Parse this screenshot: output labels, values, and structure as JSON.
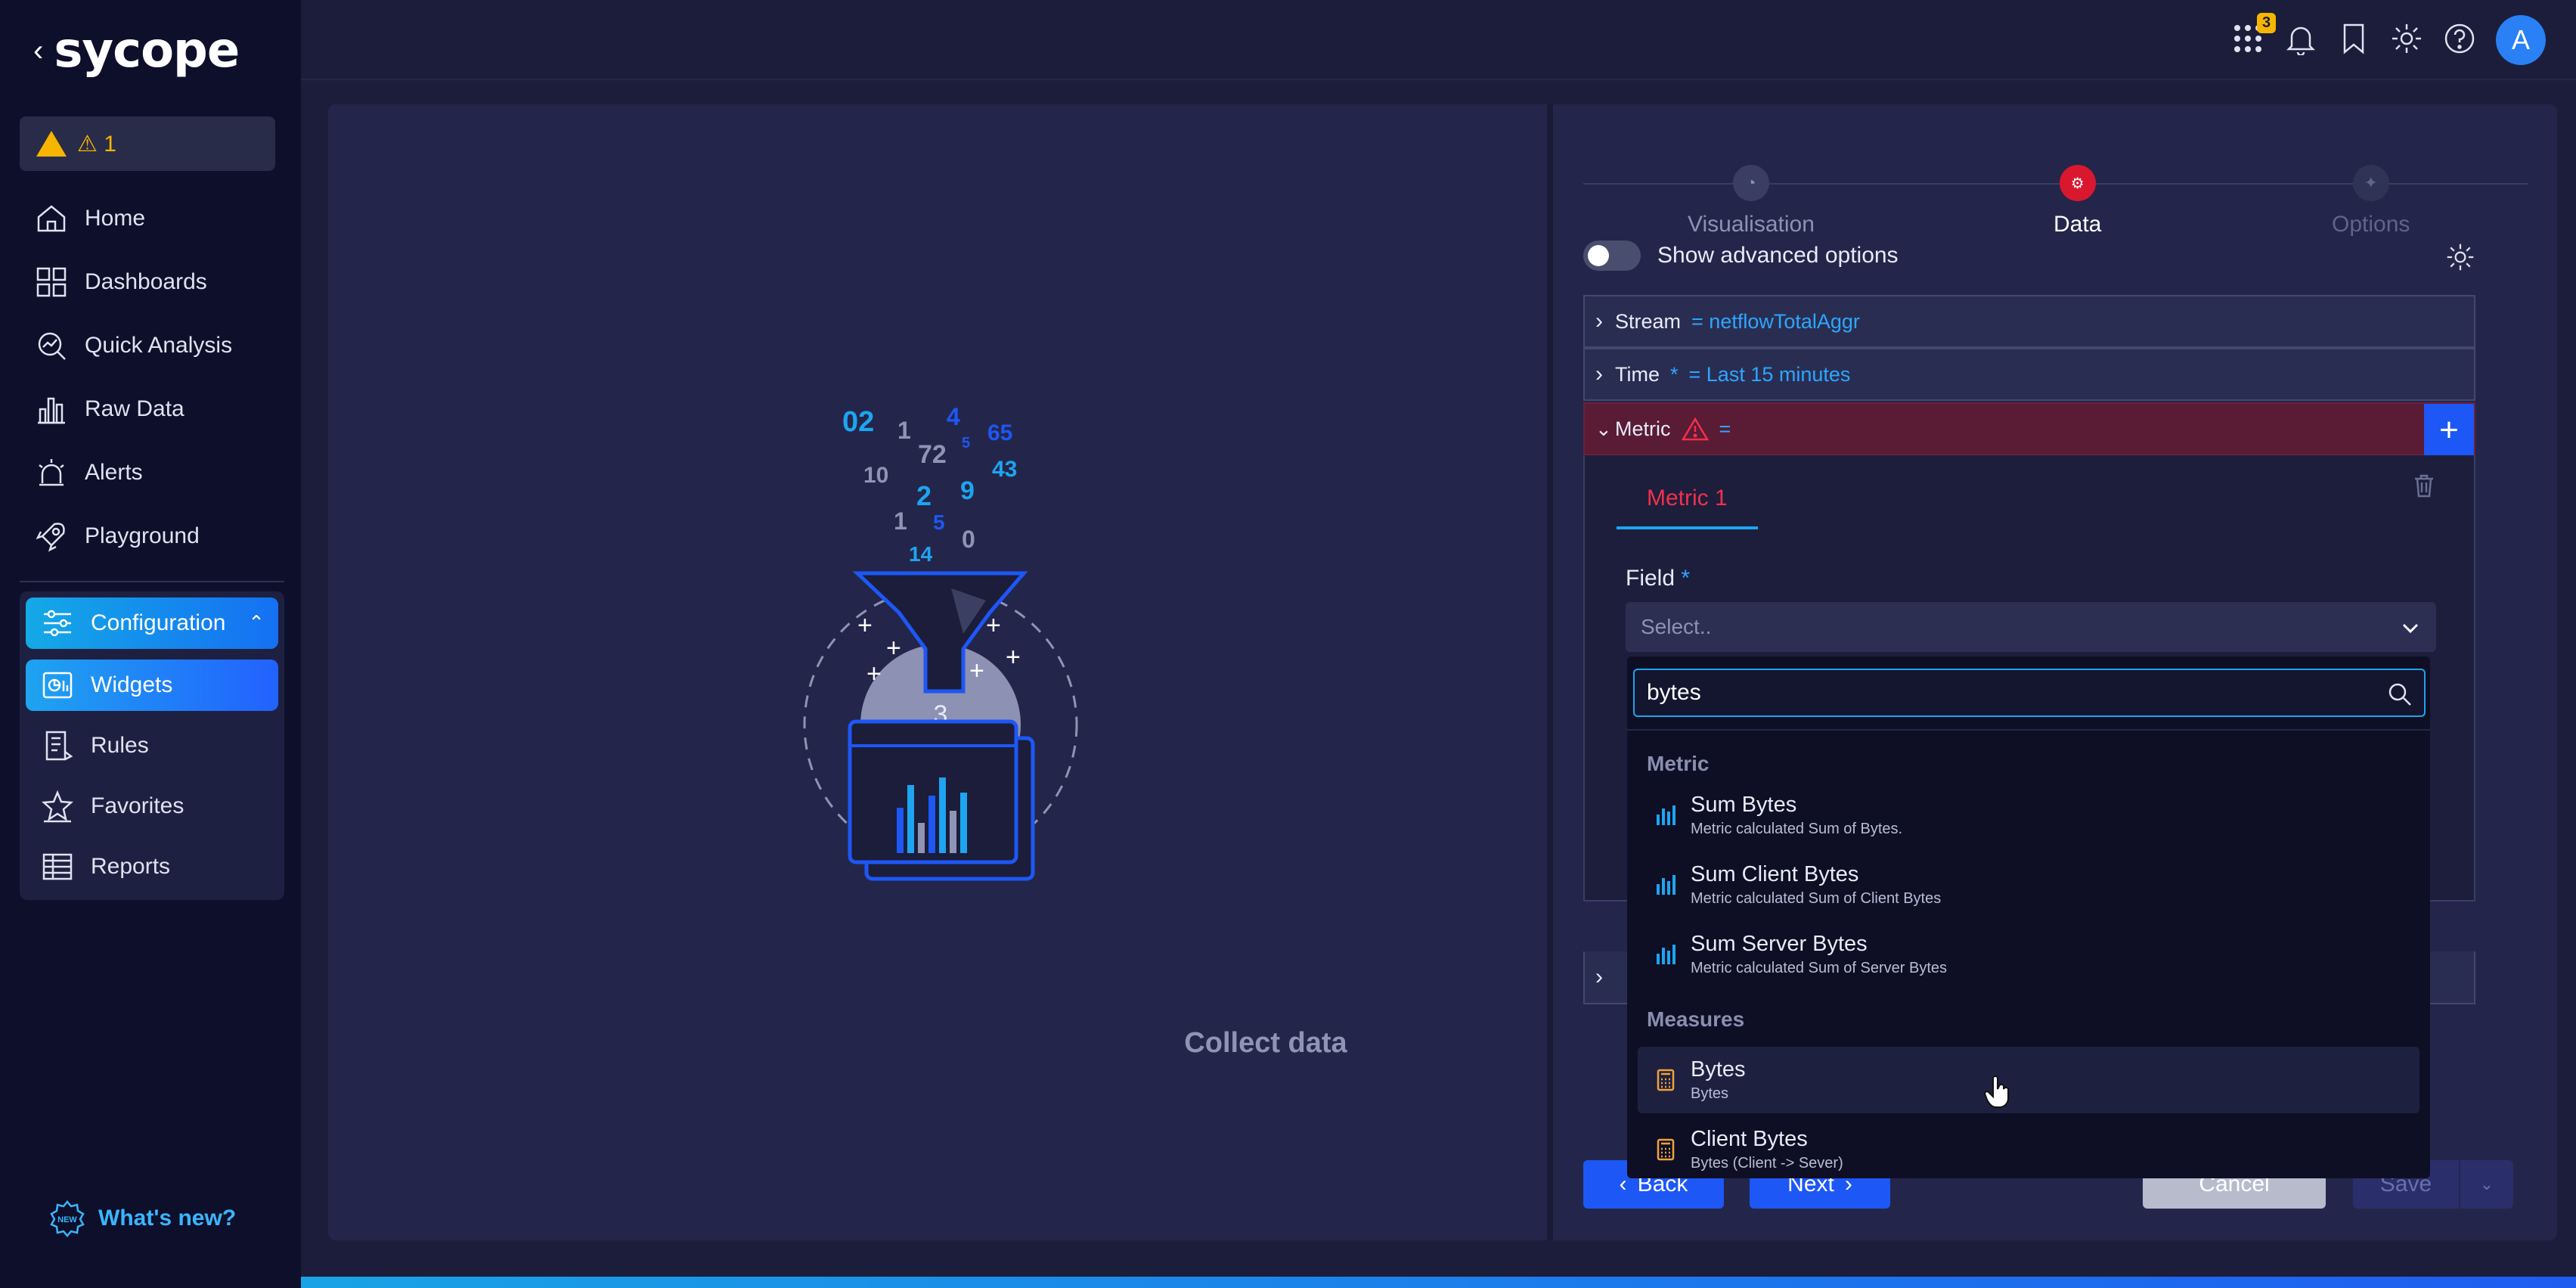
{
  "brand": {
    "logo_text": "sycope"
  },
  "alerts": {
    "count_label": "⚠ 1"
  },
  "sidebar": {
    "items": [
      {
        "label": "Home"
      },
      {
        "label": "Dashboards"
      },
      {
        "label": "Quick Analysis"
      },
      {
        "label": "Raw Data"
      },
      {
        "label": "Alerts"
      },
      {
        "label": "Playground"
      }
    ],
    "config": {
      "label": "Configuration",
      "children": [
        {
          "label": "Widgets"
        },
        {
          "label": "Rules"
        },
        {
          "label": "Favorites"
        },
        {
          "label": "Reports"
        }
      ]
    },
    "whats_new": "What's new?"
  },
  "topbar": {
    "notification_badge": "3",
    "avatar_letter": "A"
  },
  "illustration": {
    "caption": "Collect data",
    "numbers": [
      "02",
      "1",
      "4",
      "5",
      "65",
      "72",
      "43",
      "10",
      "2",
      "9",
      "1",
      "5",
      "0",
      "14"
    ],
    "center_number": "3"
  },
  "wizard": {
    "steps": [
      {
        "label": "Visualisation",
        "state": "inactive"
      },
      {
        "label": "Data",
        "state": "active"
      },
      {
        "label": "Options",
        "state": "inactive"
      }
    ],
    "advanced_label": "Show advanced options",
    "sections": {
      "stream": {
        "label": "Stream",
        "value": "= netflowTotalAggr"
      },
      "time": {
        "label": "Time",
        "required": "*",
        "value": "= Last 15 minutes"
      },
      "metric": {
        "label": "Metric",
        "value": "="
      }
    },
    "metric_tab": "Metric 1",
    "field_label": "Field",
    "field_required": "*",
    "field_placeholder": "Select.."
  },
  "dropdown": {
    "search_value": "bytes",
    "groups": [
      {
        "title": "Metric",
        "options": [
          {
            "title": "Sum Bytes",
            "subtitle": "Metric calculated Sum of Bytes.",
            "icon": "metric-bars-icon"
          },
          {
            "title": "Sum Client Bytes",
            "subtitle": "Metric calculated Sum of Client Bytes",
            "icon": "metric-bars-icon"
          },
          {
            "title": "Sum Server Bytes",
            "subtitle": "Metric calculated Sum of Server Bytes",
            "icon": "metric-bars-icon"
          }
        ]
      },
      {
        "title": "Measures",
        "options": [
          {
            "title": "Bytes",
            "subtitle": "Bytes",
            "icon": "calculator-icon"
          },
          {
            "title": "Client Bytes",
            "subtitle": "Bytes (Client -> Sever)",
            "icon": "calculator-icon"
          }
        ]
      }
    ]
  },
  "footer": {
    "back": "Back",
    "next": "Next",
    "cancel": "Cancel",
    "save": "Save"
  },
  "colors": {
    "accent": "#1d57f5",
    "cyan": "#1ea4f0",
    "error": "#f2304b",
    "warning": "#f7b500"
  }
}
